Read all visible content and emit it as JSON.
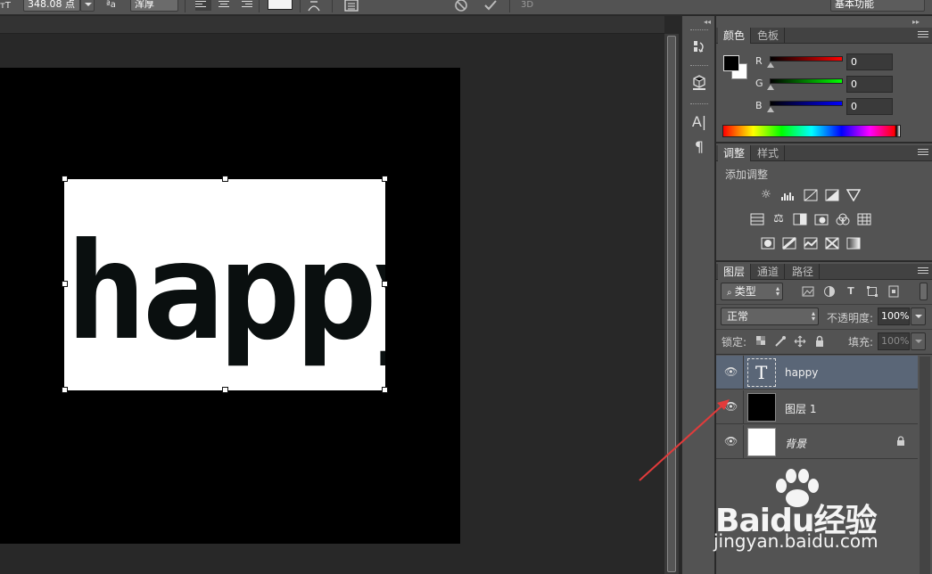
{
  "options_bar": {
    "font_size": "348.08 点",
    "antialias": "浑厚"
  },
  "workspace": {
    "name": "基本功能"
  },
  "canvas": {
    "text": "happy"
  },
  "color_panel": {
    "tabs": [
      "颜色",
      "色板"
    ],
    "channels": [
      {
        "label": "R",
        "value": "0",
        "color": "#ff0000"
      },
      {
        "label": "G",
        "value": "0",
        "color": "#00ff00"
      },
      {
        "label": "B",
        "value": "0",
        "color": "#0000ff"
      }
    ]
  },
  "adjustments_panel": {
    "tabs": [
      "调整",
      "样式"
    ],
    "title": "添加调整"
  },
  "layers_panel": {
    "tabs": [
      "图层",
      "通道",
      "路径"
    ],
    "filter_kind": "类型",
    "blend_mode": "正常",
    "opacity_label": "不透明度:",
    "opacity_value": "100%",
    "lock_label": "锁定:",
    "fill_label": "填充:",
    "fill_value": "100%",
    "layers": [
      {
        "name": "happy",
        "type": "text",
        "selected": true
      },
      {
        "name": "图层 1",
        "type": "fill-black",
        "selected": false
      },
      {
        "name": "背景",
        "type": "fill-white",
        "selected": false,
        "locked": true
      }
    ]
  },
  "watermark": {
    "brand": "Baidu经验",
    "url": "jingyan.baidu.com"
  }
}
